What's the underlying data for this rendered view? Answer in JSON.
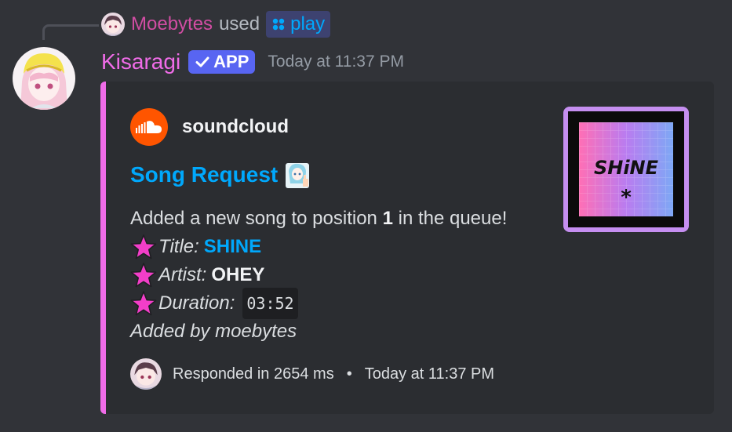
{
  "reply": {
    "username": "Moebytes",
    "used_text": "used",
    "command": "play"
  },
  "message": {
    "bot_name": "Kisaragi",
    "badge_label": "APP",
    "timestamp": "Today at 11:37 PM"
  },
  "embed": {
    "accent_color": "#f06ce8",
    "provider": "soundcloud",
    "title": "Song Request",
    "description_prefix": "Added a new song to position",
    "position": "1",
    "description_suffix": "in the queue!",
    "fields": [
      {
        "label": "Title:",
        "value": "SHINE"
      },
      {
        "label": "Artist:",
        "value": "OHEY"
      },
      {
        "label": "Duration:",
        "value": "03:52"
      }
    ],
    "added_by": "Added by moebytes",
    "thumbnail_text": "SHiNE",
    "footer_text": "Responded in 2654 ms",
    "footer_separator": "•",
    "footer_timestamp": "Today at 11:37 PM"
  }
}
